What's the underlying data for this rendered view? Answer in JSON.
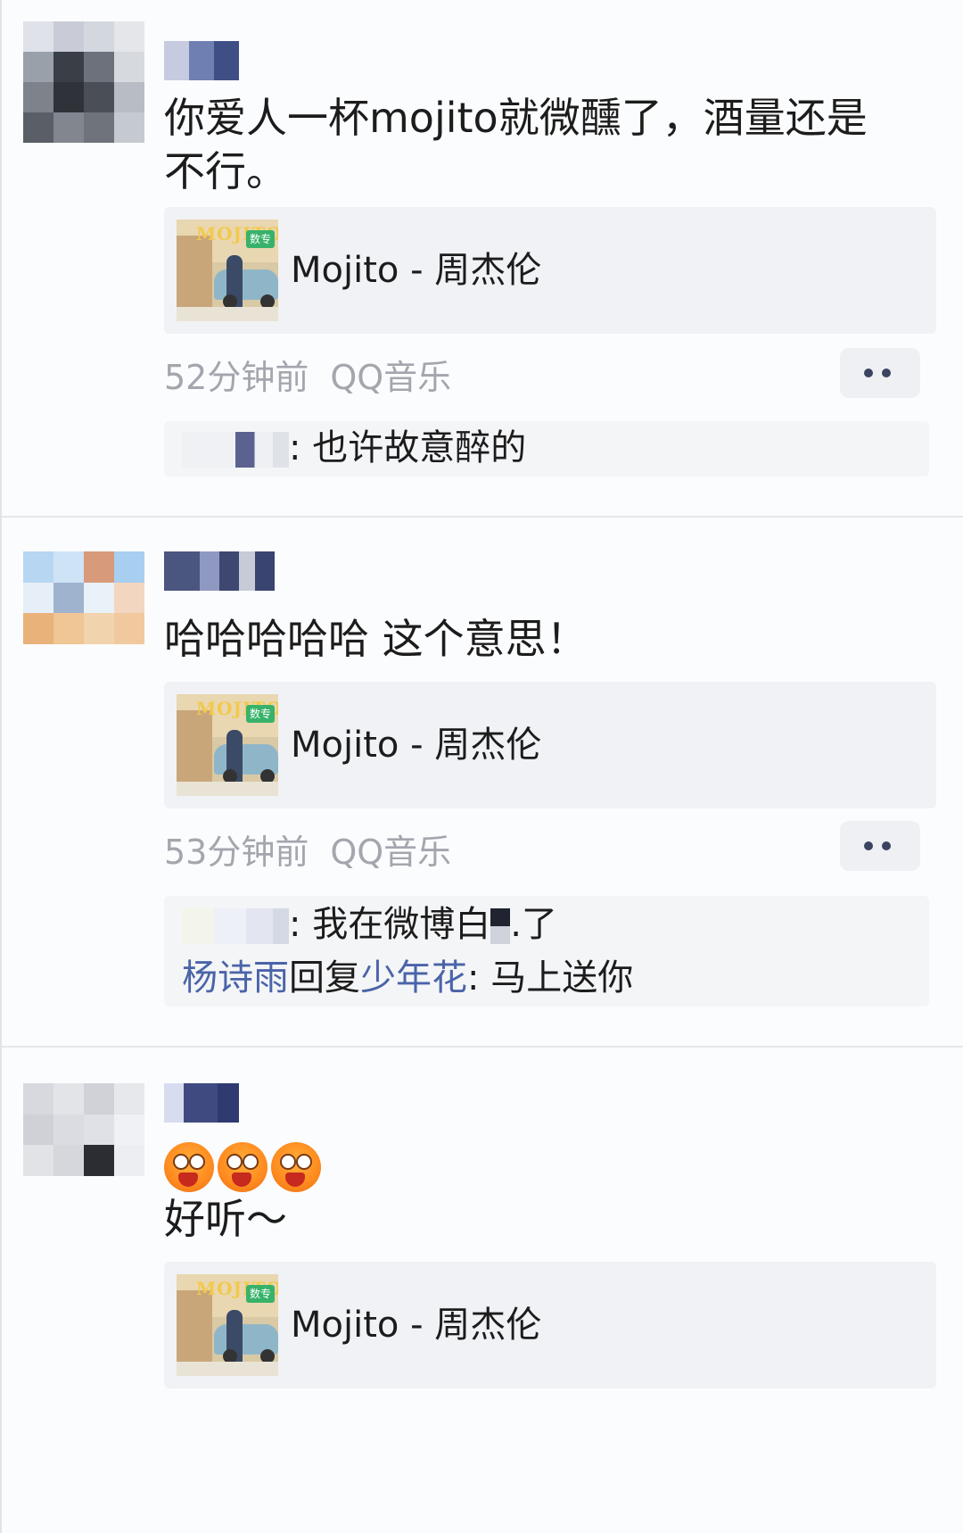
{
  "posts": [
    {
      "text": "你爱人一杯mojito就微醺了，酒量还是\n不行。",
      "song_card": {
        "title": "Mojito - 周杰伦",
        "cover_logo": "MOJITO",
        "cover_tag": "数专"
      },
      "time": "52分钟前",
      "source": "QQ音乐",
      "replies": [
        {
          "text": ": 也许故意醉的"
        }
      ]
    },
    {
      "text": "哈哈哈哈哈 这个意思！",
      "song_card": {
        "title": "Mojito - 周杰伦",
        "cover_logo": "MOJITO",
        "cover_tag": "数专"
      },
      "time": "53分钟前",
      "source": "QQ音乐",
      "replies": [
        {
          "text_before": ": 我在微博白",
          "text_after": ".了"
        },
        {
          "from": "杨诗雨",
          "verb": "回复",
          "to": "少年花",
          "text": ": 马上送你"
        }
      ]
    },
    {
      "text": "好听～",
      "emoji": [
        "surprised-face-emoji",
        "surprised-face-emoji",
        "surprised-face-emoji"
      ],
      "song_card": {
        "title": "Mojito - 周杰伦",
        "cover_logo": "MOJITO",
        "cover_tag": "数专"
      }
    }
  ],
  "colors": {
    "accent_blue": "#4a64a8",
    "meta_gray": "#a3a6ad",
    "card_bg": "#f1f2f5"
  },
  "icons": {
    "more": "more-dots-icon"
  }
}
